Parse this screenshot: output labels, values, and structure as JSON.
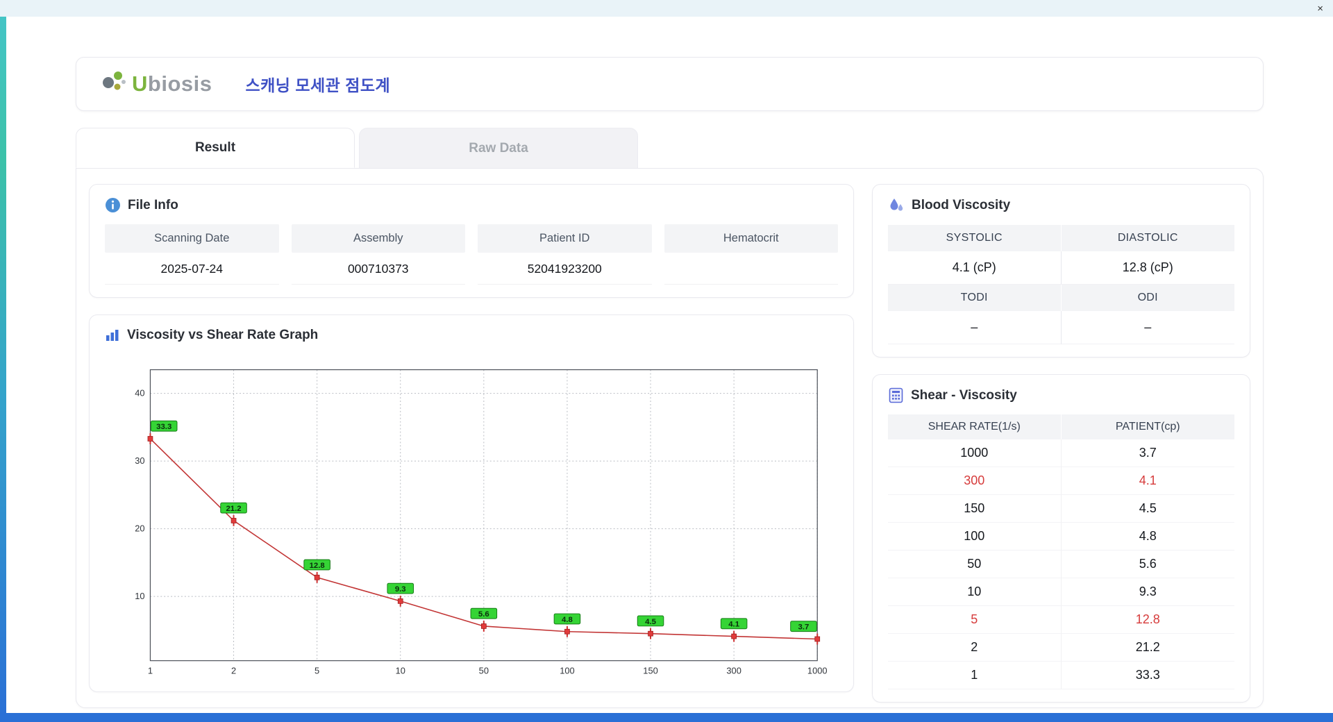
{
  "window": {
    "close_icon": "×"
  },
  "header": {
    "logo_u": "U",
    "logo_rest": "biosis",
    "title": "스캐닝 모세관 점도계"
  },
  "tabs": [
    {
      "label": "Result",
      "active": true
    },
    {
      "label": "Raw Data",
      "active": false
    }
  ],
  "file_info": {
    "title": "File Info",
    "fields": [
      {
        "label": "Scanning Date",
        "value": "2025-07-24"
      },
      {
        "label": "Assembly",
        "value": "000710373"
      },
      {
        "label": "Patient ID",
        "value": "52041923200"
      },
      {
        "label": "Hematocrit",
        "value": ""
      }
    ]
  },
  "graph_card": {
    "title": "Viscosity vs Shear Rate Graph"
  },
  "chart_data": {
    "type": "line",
    "title": "Viscosity vs Shear Rate Graph",
    "x": [
      1,
      2,
      5,
      10,
      50,
      100,
      150,
      300,
      1000
    ],
    "values": [
      33.3,
      21.2,
      12.8,
      9.3,
      5.6,
      4.8,
      4.5,
      4.1,
      3.7
    ],
    "point_labels": [
      "33.3",
      "21.2",
      "12.8",
      "9.3",
      "5.6",
      "4.8",
      "4.5",
      "4.1",
      "3.7"
    ],
    "yticks": [
      10,
      20,
      30,
      40
    ],
    "ylim": [
      0.5,
      43.5
    ],
    "xlabel": "",
    "ylabel": "",
    "grid": true,
    "legend": "none",
    "line_color": "#c23434",
    "marker_color": "#e23b3b",
    "point_label_bg": "#35d435"
  },
  "blood_viscosity": {
    "title": "Blood Viscosity",
    "row1": {
      "label_left": "SYSTOLIC",
      "label_right": "DIASTOLIC",
      "value_left": "4.1 (cP)",
      "value_right": "12.8 (cP)"
    },
    "row2": {
      "label_left": "TODI",
      "label_right": "ODI",
      "value_left": "–",
      "value_right": "–"
    }
  },
  "shear_viscosity": {
    "title": "Shear - Viscosity",
    "columns": [
      "SHEAR RATE(1/s)",
      "PATIENT(cp)"
    ],
    "rows": [
      {
        "rate": "1000",
        "value": "3.7",
        "highlight": false
      },
      {
        "rate": "300",
        "value": "4.1",
        "highlight": true
      },
      {
        "rate": "150",
        "value": "4.5",
        "highlight": false
      },
      {
        "rate": "100",
        "value": "4.8",
        "highlight": false
      },
      {
        "rate": "50",
        "value": "5.6",
        "highlight": false
      },
      {
        "rate": "10",
        "value": "9.3",
        "highlight": false
      },
      {
        "rate": "5",
        "value": "12.8",
        "highlight": true
      },
      {
        "rate": "2",
        "value": "21.2",
        "highlight": false
      },
      {
        "rate": "1",
        "value": "33.3",
        "highlight": false
      }
    ]
  }
}
